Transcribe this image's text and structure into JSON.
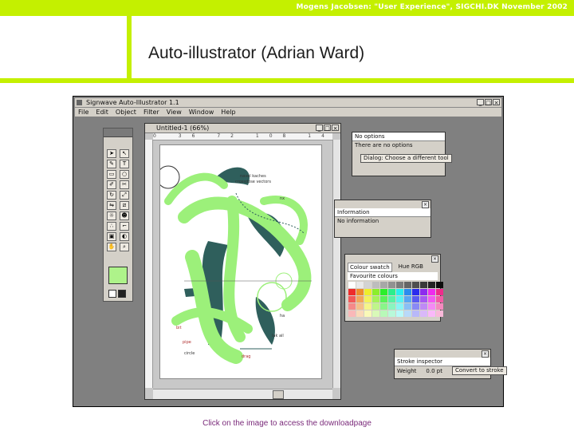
{
  "slide": {
    "header": "Mogens Jacobsen: \"User Experience\", SIGCHI.DK November 2002",
    "title": "Auto-illustrator (Adrian Ward)",
    "footer_link": "Click on the image to access the downloadpage"
  },
  "app": {
    "title": "Signwave Auto-Illustrator 1.1",
    "menu": [
      "File",
      "Edit",
      "Object",
      "Filter",
      "View",
      "Window",
      "Help"
    ],
    "window_buttons": [
      "_",
      "□",
      "×"
    ],
    "document": {
      "title": "Untitled-1 (66%)",
      "ruler_ticks": [
        "0",
        "36",
        "72",
        "108",
        "144",
        "180",
        "216",
        "252"
      ],
      "artwork_texts": [
        "navel kaches",
        "crossdose vectors",
        "nx",
        "bit",
        "pipe",
        "ha",
        "lak ail",
        "circle",
        "drag"
      ]
    },
    "panels": {
      "options": {
        "title": "No options",
        "line": "There are no options",
        "button": "Dialog: Choose a different tool"
      },
      "information": {
        "title": "Information",
        "line": "No information"
      },
      "colour": {
        "tab1": "Colour swatch",
        "tab2": "Hue RGB",
        "subtitle": "Favourite colours"
      },
      "stroke": {
        "title": "Stroke inspector",
        "label": "Weight",
        "value": "0.0 pt",
        "button": "Convert to stroke"
      }
    },
    "colors": {
      "accent": "#c4f000",
      "brush_green": "#9cf07a",
      "dark_teal": "#2f5f5c"
    }
  }
}
